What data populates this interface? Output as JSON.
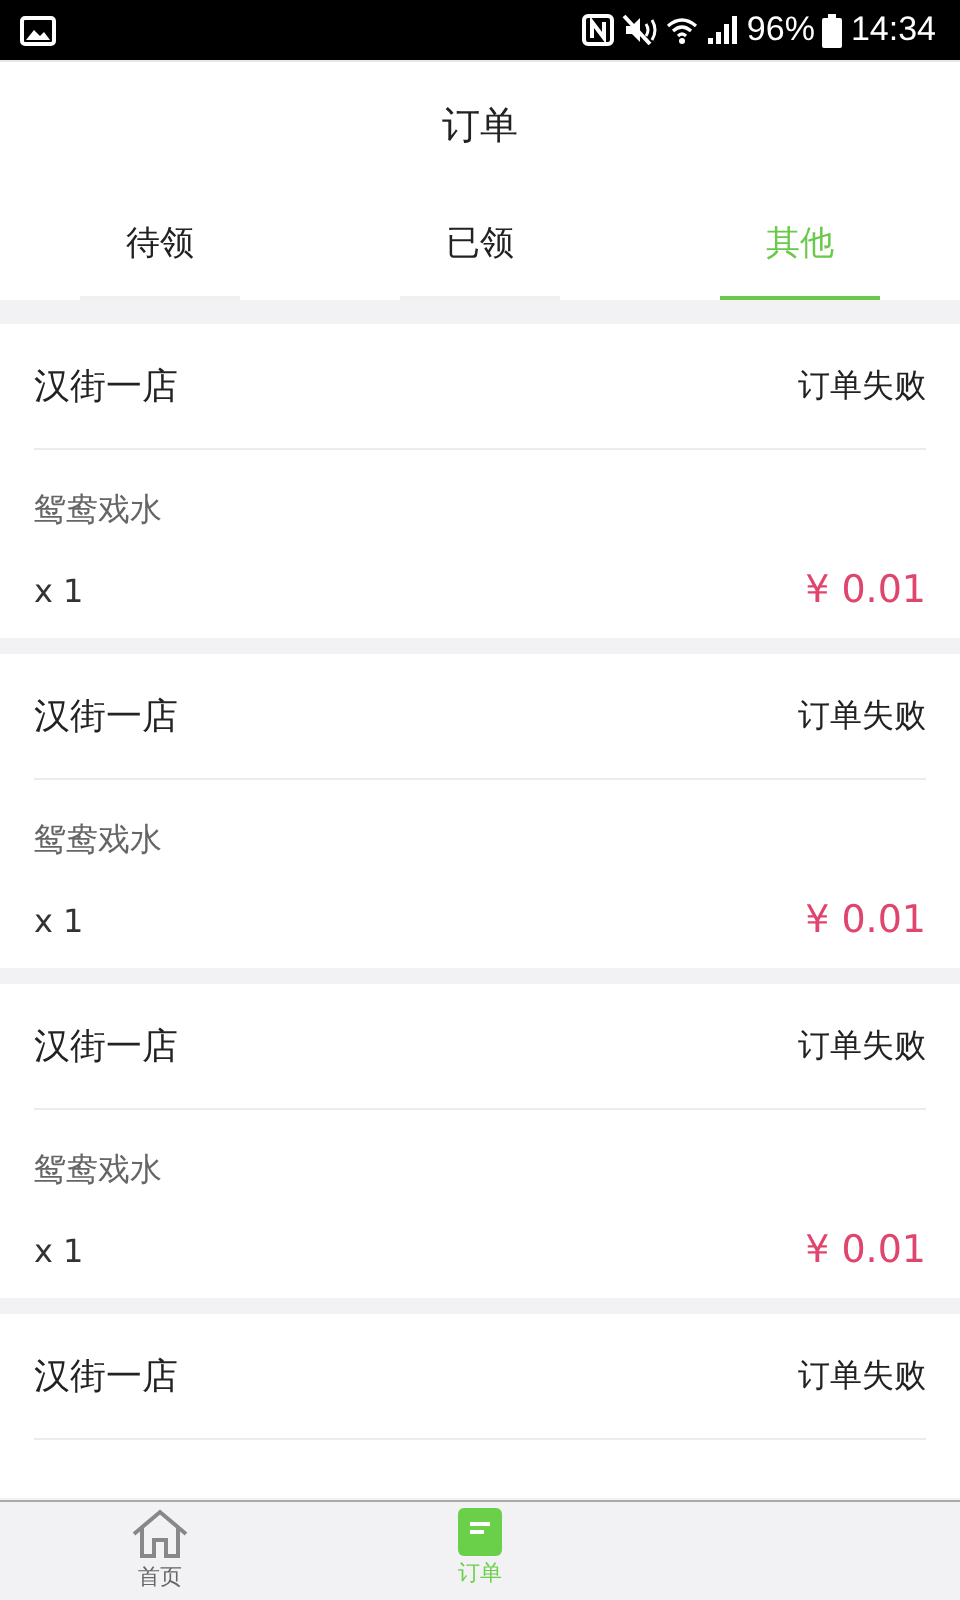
{
  "status_bar": {
    "battery": "96%",
    "time": "14:34"
  },
  "title": "订单",
  "tabs": [
    {
      "label": "待领",
      "selected": false
    },
    {
      "label": "已领",
      "selected": false
    },
    {
      "label": "其他",
      "selected": true
    }
  ],
  "orders": [
    {
      "shop": "汉街一店",
      "status": "订单失败",
      "item": "鸳鸯戏水",
      "quantity": "x 1",
      "price": "¥ 0.01"
    },
    {
      "shop": "汉街一店",
      "status": "订单失败",
      "item": "鸳鸯戏水",
      "quantity": "x 1",
      "price": "¥ 0.01"
    },
    {
      "shop": "汉街一店",
      "status": "订单失败",
      "item": "鸳鸯戏水",
      "quantity": "x 1",
      "price": "¥ 0.01"
    },
    {
      "shop": "汉街一店",
      "status": "订单失败"
    }
  ],
  "bottom_nav": [
    {
      "label": "首页",
      "kind": "home",
      "selected": false
    },
    {
      "label": "订单",
      "kind": "orders",
      "selected": true
    }
  ]
}
